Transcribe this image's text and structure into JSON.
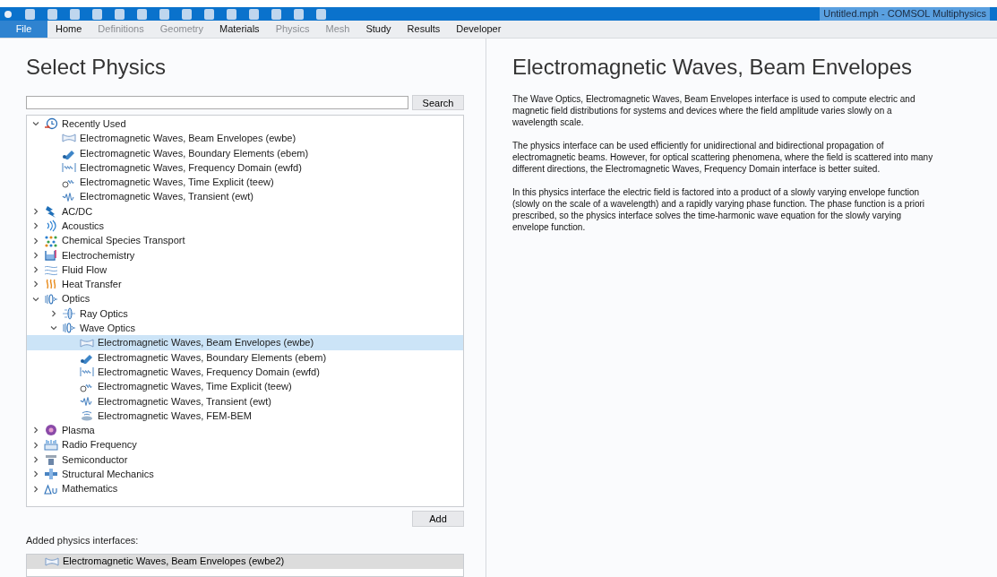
{
  "window": {
    "title": "Untitled.mph - COMSOL Multiphysics"
  },
  "menu": [
    {
      "label": "File",
      "selected": true,
      "disabled": false
    },
    {
      "label": "Home",
      "selected": false,
      "disabled": false
    },
    {
      "label": "Definitions",
      "selected": false,
      "disabled": true
    },
    {
      "label": "Geometry",
      "selected": false,
      "disabled": true
    },
    {
      "label": "Materials",
      "selected": false,
      "disabled": false
    },
    {
      "label": "Physics",
      "selected": false,
      "disabled": true
    },
    {
      "label": "Mesh",
      "selected": false,
      "disabled": true
    },
    {
      "label": "Study",
      "selected": false,
      "disabled": false
    },
    {
      "label": "Results",
      "selected": false,
      "disabled": false
    },
    {
      "label": "Developer",
      "selected": false,
      "disabled": false
    }
  ],
  "left": {
    "heading": "Select Physics",
    "search_button": "Search",
    "tree": [
      {
        "label": "Recently Used",
        "kind": "clock",
        "expanded": true,
        "selected": false,
        "children": [
          {
            "label": "Electromagnetic Waves, Beam Envelopes (ewbe)",
            "kind": "beam",
            "selected": false
          },
          {
            "label": "Electromagnetic Waves, Boundary Elements (ebem)",
            "kind": "boundary",
            "selected": false
          },
          {
            "label": "Electromagnetic Waves, Frequency Domain (ewfd)",
            "kind": "frequency",
            "selected": false
          },
          {
            "label": "Electromagnetic Waves, Time Explicit (teew)",
            "kind": "time",
            "selected": false
          },
          {
            "label": "Electromagnetic Waves, Transient (ewt)",
            "kind": "transient",
            "selected": false
          }
        ]
      },
      {
        "label": "AC/DC",
        "kind": "acdc",
        "expanded": false,
        "selected": false
      },
      {
        "label": "Acoustics",
        "kind": "acoustics",
        "expanded": false,
        "selected": false
      },
      {
        "label": "Chemical Species Transport",
        "kind": "chemical",
        "expanded": false,
        "selected": false
      },
      {
        "label": "Electrochemistry",
        "kind": "electrochem",
        "expanded": false,
        "selected": false
      },
      {
        "label": "Fluid Flow",
        "kind": "fluid",
        "expanded": false,
        "selected": false
      },
      {
        "label": "Heat Transfer",
        "kind": "heat",
        "expanded": false,
        "selected": false
      },
      {
        "label": "Optics",
        "kind": "optics",
        "expanded": true,
        "selected": false,
        "children": [
          {
            "label": "Ray Optics",
            "kind": "ray",
            "expanded": false,
            "selected": false
          },
          {
            "label": "Wave Optics",
            "kind": "optics",
            "expanded": true,
            "selected": false,
            "children": [
              {
                "label": "Electromagnetic Waves, Beam Envelopes (ewbe)",
                "kind": "beam",
                "selected": true
              },
              {
                "label": "Electromagnetic Waves, Boundary Elements (ebem)",
                "kind": "boundary",
                "selected": false
              },
              {
                "label": "Electromagnetic Waves, Frequency Domain (ewfd)",
                "kind": "frequency",
                "selected": false
              },
              {
                "label": "Electromagnetic Waves, Time Explicit (teew)",
                "kind": "time",
                "selected": false
              },
              {
                "label": "Electromagnetic Waves, Transient (ewt)",
                "kind": "transient",
                "selected": false
              },
              {
                "label": "Electromagnetic Waves, FEM-BEM",
                "kind": "fembem",
                "selected": false
              }
            ]
          }
        ]
      },
      {
        "label": "Plasma",
        "kind": "plasma",
        "expanded": false,
        "selected": false
      },
      {
        "label": "Radio Frequency",
        "kind": "radio",
        "expanded": false,
        "selected": false
      },
      {
        "label": "Semiconductor",
        "kind": "semiconductor",
        "expanded": false,
        "selected": false
      },
      {
        "label": "Structural Mechanics",
        "kind": "structural",
        "expanded": false,
        "selected": false
      },
      {
        "label": "Mathematics",
        "kind": "math",
        "expanded": false,
        "selected": false
      }
    ],
    "add_button": "Add",
    "added_label": "Added physics interfaces:",
    "added": [
      {
        "label": "Electromagnetic Waves, Beam Envelopes (ewbe2)",
        "kind": "beam",
        "selected": true
      }
    ]
  },
  "right": {
    "title": "Electromagnetic Waves, Beam Envelopes",
    "paragraphs": [
      "The Wave Optics, Electromagnetic Waves, Beam Envelopes interface is used to compute electric and magnetic field distributions for systems and devices where the field amplitude varies slowly on a wavelength scale.",
      "The physics interface can be used efficiently for unidirectional and bidirectional propagation of electromagnetic beams. However, for optical scattering phenomena, where the field is scattered into many different directions, the Electromagnetic Waves, Frequency Domain interface is better suited.",
      "In this physics interface the electric field is factored into a product of a slowly varying envelope function (slowly on the scale of a wavelength) and a rapidly varying phase function. The phase function is a priori prescribed, so the physics interface solves the time-harmonic wave equation for the slowly varying envelope function."
    ]
  }
}
